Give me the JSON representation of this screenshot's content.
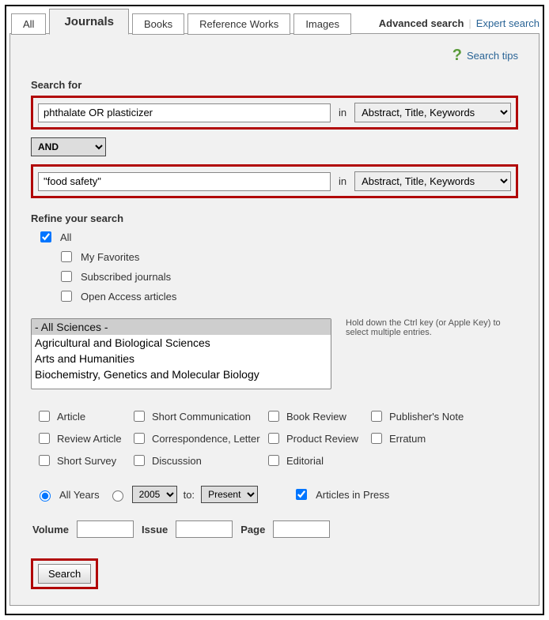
{
  "tabs": {
    "all": "All",
    "journals": "Journals",
    "books": "Books",
    "refworks": "Reference Works",
    "images": "Images"
  },
  "topright": {
    "advanced": "Advanced search",
    "expert": "Expert search"
  },
  "tips": {
    "label": "Search tips"
  },
  "search": {
    "heading": "Search for",
    "term1": "phthalate OR plasticizer",
    "in_label": "in",
    "field1": "Abstract, Title, Keywords",
    "bool": "AND",
    "term2": "\"food safety\"",
    "field2": "Abstract, Title, Keywords"
  },
  "refine": {
    "heading": "Refine your search",
    "all": "All",
    "fav": "My Favorites",
    "sub": "Subscribed journals",
    "oa": "Open Access articles"
  },
  "subjects": {
    "hint": "Hold down the Ctrl key (or Apple Key) to select multiple entries.",
    "opts": [
      "- All Sciences -",
      "Agricultural and Biological Sciences",
      "Arts and Humanities",
      "Biochemistry, Genetics and Molecular Biology"
    ]
  },
  "atype": {
    "article": "Article",
    "shortcomm": "Short Communication",
    "bookrev": "Book Review",
    "pubnote": "Publisher's Note",
    "review": "Review Article",
    "corr": "Correspondence, Letter",
    "prodrev": "Product Review",
    "erratum": "Erratum",
    "survey": "Short Survey",
    "disc": "Discussion",
    "editorial": "Editorial"
  },
  "years": {
    "all": "All Years",
    "from": "2005",
    "to_label": "to:",
    "to": "Present",
    "aip": "Articles in Press"
  },
  "vip": {
    "volume": "Volume",
    "issue": "Issue",
    "page": "Page"
  },
  "button": {
    "search": "Search"
  }
}
